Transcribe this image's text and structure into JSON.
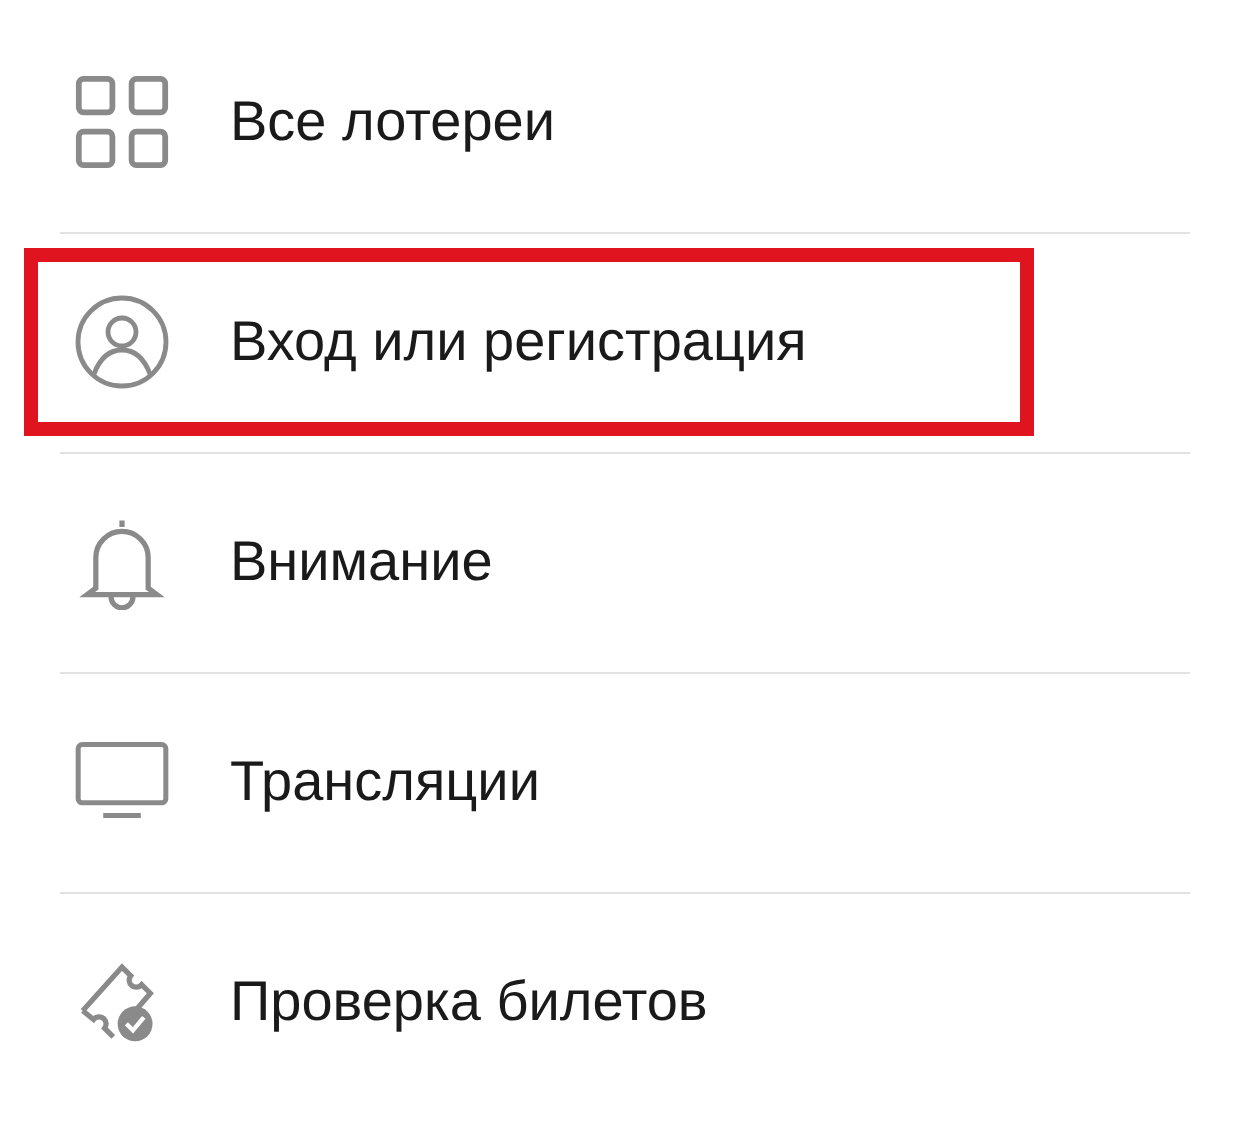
{
  "menu": {
    "items": [
      {
        "kind": "grid",
        "label": "Все лотереи",
        "highlighted": false
      },
      {
        "kind": "user",
        "label": "Вход или регистрация",
        "highlighted": true
      },
      {
        "kind": "bell",
        "label": "Внимание",
        "highlighted": false
      },
      {
        "kind": "monitor",
        "label": "Трансляции",
        "highlighted": false
      },
      {
        "kind": "ticket",
        "label": "Проверка билетов",
        "highlighted": false
      }
    ]
  }
}
